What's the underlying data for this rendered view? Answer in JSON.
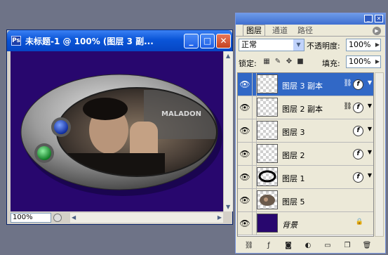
{
  "document": {
    "title": "未标题-1 @ 100% (图层 3 副...",
    "zoom": "100%"
  },
  "artwork": {
    "logo_text": "MALADON",
    "colors": {
      "background": "#28076e",
      "button_blue": "#1a3fc0",
      "button_green": "#1fae3a"
    }
  },
  "panel": {
    "tabs": [
      "图层",
      "通道",
      "路径"
    ],
    "blend_mode": "正常",
    "opacity_label": "不透明度:",
    "opacity_value": "100%",
    "lock_label": "锁定:",
    "fill_label": "填充:",
    "fill_value": "100%",
    "layers": [
      {
        "name": "图层 3 副本",
        "selected": true,
        "linked": true,
        "fx": true
      },
      {
        "name": "图层 2 副本",
        "selected": false,
        "linked": true,
        "fx": true
      },
      {
        "name": "图层 3",
        "selected": false,
        "linked": false,
        "fx": true
      },
      {
        "name": "图层 2",
        "selected": false,
        "linked": false,
        "fx": true
      },
      {
        "name": "图层 1",
        "selected": false,
        "linked": false,
        "fx": true
      },
      {
        "name": "图层 5",
        "selected": false,
        "linked": false,
        "fx": false
      },
      {
        "name": "背景",
        "selected": false,
        "linked": false,
        "fx": false,
        "locked": true
      }
    ]
  }
}
